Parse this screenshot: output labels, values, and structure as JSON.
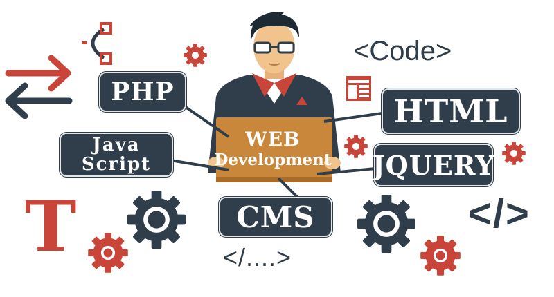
{
  "tags": {
    "php": "PHP",
    "html": "HTML",
    "javascript_line1": "Java",
    "javascript_line2": "Script",
    "jquery": "JQUERY",
    "cms": "CMS"
  },
  "laptop": {
    "line1": "WEB",
    "line2": "Development"
  },
  "code_snippets": {
    "top": "<Code>",
    "bottom": "</....>",
    "right": "</>"
  },
  "font_icon_letter": "T",
  "icons": [
    "bezier-curve-icon",
    "swap-arrows-icon",
    "gear-icon",
    "layout-icon",
    "font-icon",
    "developer-illustration"
  ],
  "colors": {
    "dark": "#2f3e4a",
    "red": "#c9453a",
    "orange": "#c8873a",
    "skin": "#f2c48d"
  }
}
